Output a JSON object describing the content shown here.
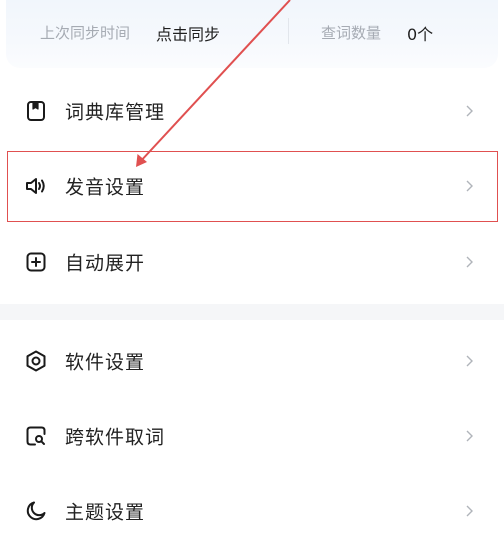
{
  "sync": {
    "last_sync_label": "上次同步时间",
    "sync_action": "点击同步",
    "lookup_count_label": "查词数量",
    "lookup_count_value": "0个"
  },
  "menu_group1": [
    {
      "label": "词典库管理",
      "icon": "bookmark-icon"
    },
    {
      "label": "发音设置",
      "icon": "speaker-icon",
      "highlighted": true
    },
    {
      "label": "自动展开",
      "icon": "plus-square-icon"
    }
  ],
  "menu_group2": [
    {
      "label": "软件设置",
      "icon": "gear-hexagon-icon"
    },
    {
      "label": "跨软件取词",
      "icon": "search-square-icon"
    },
    {
      "label": "主题设置",
      "icon": "moon-icon"
    }
  ],
  "annotation": {
    "highlight_color": "#e05050",
    "arrow_color": "#e05050"
  }
}
